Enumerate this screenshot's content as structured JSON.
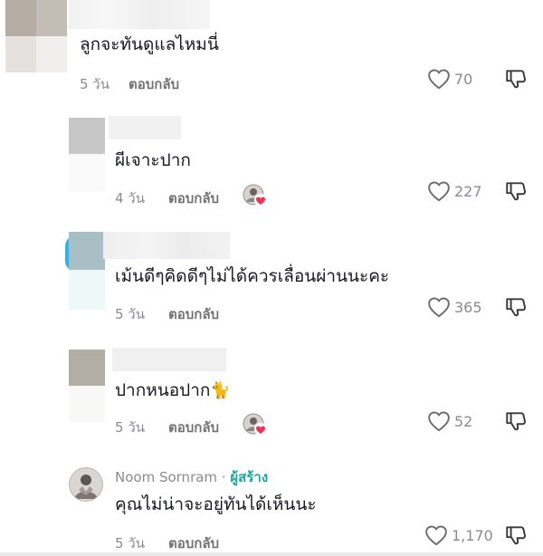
{
  "comments": [
    {
      "text": "ลูกจะทันดูแลไหมนี่",
      "time": "5 วัน",
      "reply": "ตอบกลับ",
      "likes": "70",
      "creator_liked": false
    },
    {
      "text": "ผีเจาะปาก",
      "time": "4 วัน",
      "reply": "ตอบกลับ",
      "likes": "227",
      "creator_liked": true
    },
    {
      "text": "เม้นดีๆคิดดีๆไม่ได้ควรเลื่อนผ่านนะคะ",
      "time": "5 วัน",
      "reply": "ตอบกลับ",
      "likes": "365",
      "creator_liked": false
    },
    {
      "text": "ปากหนอปาก",
      "emoji": "🐈",
      "time": "5 วัน",
      "reply": "ตอบกลับ",
      "likes": "52",
      "creator_liked": true
    },
    {
      "name": "Noom Sornram",
      "separator": "·",
      "creator_badge": "ผู้สร้าง",
      "text": "คุณไม่น่าจะอยู่ทันได้เห็นนะ",
      "time": "5 วัน",
      "reply": "ตอบกลับ",
      "likes": "1,170",
      "creator_liked": false
    }
  ],
  "icons": {
    "like": "heart-outline-icon",
    "dislike": "thumbs-down-icon",
    "creator_liked": "creator-avatar-heart-icon"
  },
  "colors": {
    "text": "#161823",
    "muted": "#8a8b91",
    "creator": "#1aa79f",
    "heart_badge": "#fe2c55"
  }
}
